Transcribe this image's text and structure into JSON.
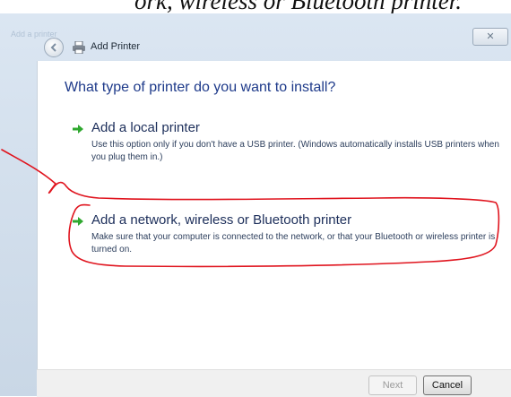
{
  "caption": "ork, wireless or Bluetooth printer.",
  "window": {
    "faint_title": "Add a printer",
    "close_label": "✕",
    "nav_title": "Add Printer"
  },
  "main": {
    "heading": "What type of printer do you want to install?",
    "options": [
      {
        "title": "Add a local printer",
        "description": "Use this option only if you don't have a USB printer. (Windows automatically installs USB printers when you plug them in.)"
      },
      {
        "title": "Add a network, wireless or Bluetooth printer",
        "description": "Make sure that your computer is connected to the network, or that your Bluetooth or wireless printer is turned on."
      }
    ]
  },
  "footer": {
    "next_label": "Next",
    "cancel_label": "Cancel"
  },
  "icons": {
    "back": "back-arrow-icon",
    "printer": "printer-icon",
    "option_arrow": "green-arrow-icon"
  },
  "colors": {
    "heading": "#1e3a8a",
    "option_arrow": "#2fa82f",
    "annotation": "#e0141e"
  }
}
